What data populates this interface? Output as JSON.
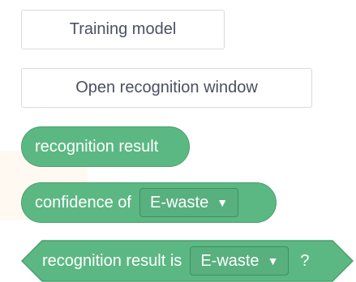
{
  "buttons": {
    "train_label": "Training model",
    "open_window_label": "Open recognition window"
  },
  "blocks": {
    "recognition_result": {
      "label": "recognition result"
    },
    "confidence": {
      "label": "confidence of",
      "dropdown_value": "E-waste",
      "dropdown_icon": "triangle-down-icon"
    },
    "result_is": {
      "label": "recognition result is",
      "dropdown_value": "E-waste",
      "dropdown_icon": "triangle-down-icon",
      "suffix": "?"
    }
  },
  "colors": {
    "block_green": "#5cb883",
    "block_border": "#4a9e6f",
    "button_border": "#d9d9e3",
    "button_text": "#4b4f63"
  }
}
